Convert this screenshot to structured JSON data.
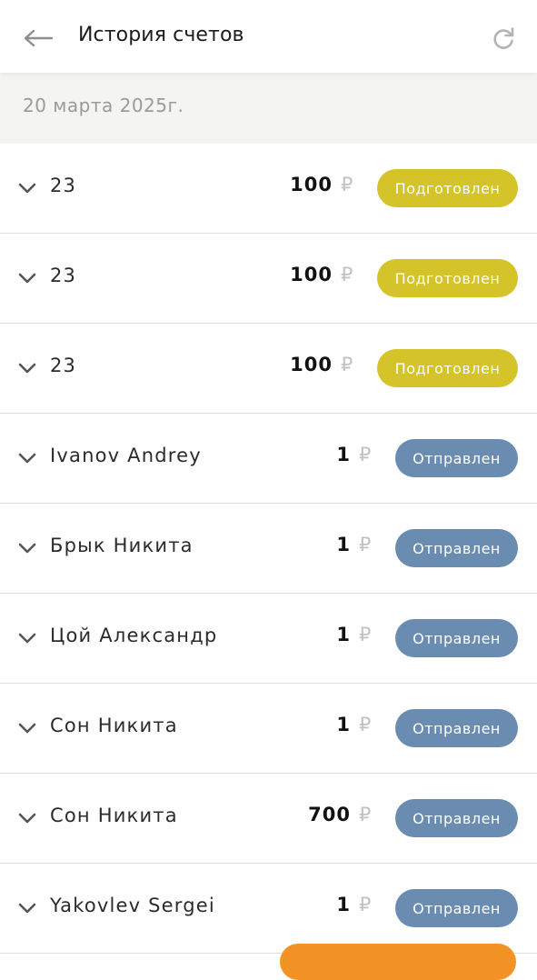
{
  "header": {
    "title": "История счетов",
    "back_icon": "arrow-left-icon",
    "refresh_icon": "refresh-icon"
  },
  "date_header": "20 марта 2025г.",
  "colors": {
    "prepared": "#d4c42a",
    "sent": "#6a8cb0",
    "fab": "#f39325"
  },
  "currency_symbol": "₽",
  "invoices": [
    {
      "name": "23",
      "amount": "100",
      "status": "Подготовлен",
      "kind": "prep"
    },
    {
      "name": "23",
      "amount": "100",
      "status": "Подготовлен",
      "kind": "prep"
    },
    {
      "name": "23",
      "amount": "100",
      "status": "Подготовлен",
      "kind": "prep"
    },
    {
      "name": "Ivanov Andrey",
      "amount": "1",
      "status": "Отправлен",
      "kind": "sent"
    },
    {
      "name": "Брык Никита",
      "amount": "1",
      "status": "Отправлен",
      "kind": "sent"
    },
    {
      "name": "Цой Александр",
      "amount": "1",
      "status": "Отправлен",
      "kind": "sent"
    },
    {
      "name": "Сон Никита",
      "amount": "1",
      "status": "Отправлен",
      "kind": "sent"
    },
    {
      "name": "Сон Никита",
      "amount": "700",
      "status": "Отправлен",
      "kind": "sent"
    },
    {
      "name": "Yakovlev Sergei",
      "amount": "1",
      "status": "Отправлен",
      "kind": "sent"
    }
  ]
}
